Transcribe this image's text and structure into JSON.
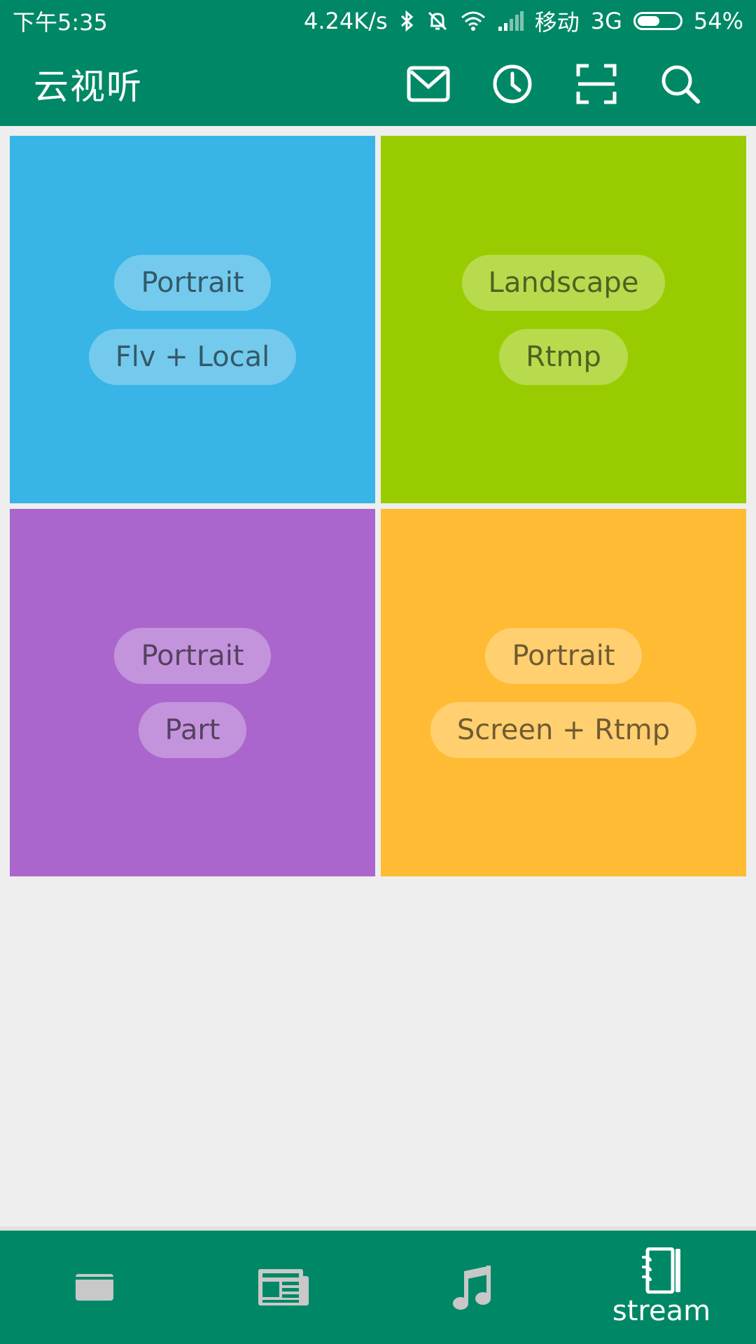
{
  "status_bar": {
    "time": "下午5:35",
    "net_speed": "4.24K/s",
    "carrier": "移动",
    "network": "3G",
    "battery": "54%",
    "battery_level": 0.54
  },
  "app_bar": {
    "title": "云视听",
    "actions": [
      {
        "name": "mail-button",
        "icon": "mail-icon"
      },
      {
        "name": "history-button",
        "icon": "clock-icon"
      },
      {
        "name": "scan-button",
        "icon": "scan-icon"
      },
      {
        "name": "search-button",
        "icon": "search-icon"
      }
    ]
  },
  "tiles": [
    {
      "color": "#38b4e6",
      "chips": [
        "Portrait",
        "Flv + Local"
      ]
    },
    {
      "color": "#99cc00",
      "chips": [
        "Landscape",
        "Rtmp"
      ]
    },
    {
      "color": "#aa66cc",
      "chips": [
        "Portrait",
        "Part"
      ]
    },
    {
      "color": "#ffbb33",
      "chips": [
        "Portrait",
        "Screen + Rtmp"
      ]
    }
  ],
  "bottom_nav": {
    "items": [
      {
        "icon": "tv-icon",
        "label": ""
      },
      {
        "icon": "news-icon",
        "label": ""
      },
      {
        "icon": "music-note-icon",
        "label": ""
      },
      {
        "icon": "notebook-icon",
        "label": "stream",
        "active": true
      }
    ]
  },
  "colors": {
    "primary": "#008866",
    "background": "#eeeeee",
    "icon_inactive": "#c8c8c8"
  }
}
